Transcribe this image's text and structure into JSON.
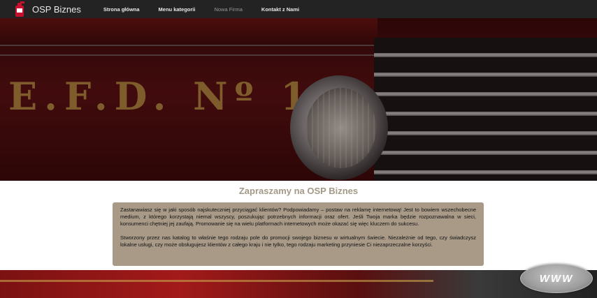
{
  "header": {
    "brand_name": "OSP Biznes",
    "logo_icon": "fire-extinguisher-icon",
    "nav_items": [
      {
        "label": "Strona główna",
        "active": false
      },
      {
        "label": "Menu kategorii",
        "active": false
      },
      {
        "label": "Nowa Firma",
        "active": true
      },
      {
        "label": "Kontakt z Nami",
        "active": false
      }
    ]
  },
  "hero": {
    "image_text": "E.F.D. Nº 1"
  },
  "main": {
    "title": "Zapraszamy na OSP Biznes",
    "paragraphs": [
      "Zastanawiasz się w jaki sposób najskuteczniej przyciągać klientów? Podpowiadamy – postaw na reklamę internetową! Jest to bowiem wszechobecne medium, z którego korzystają niemal wszyscy, poszukując potrzebnych informacji oraz ofert. Jeśli Twoja marka będzie rozpoznawalna w sieci, konsumenci chętniej jej zaufają. Promowanie się na wielu platformach internetowych może okazać się więc kluczem do sukcesu.",
      "Stworzony przez nas katalog to właśnie tego rodzaju pole do promocji swojego biznesu w wirtualnym świecie. Niezależnie od tego, czy świadczysz lokalne usługi, czy może obsługujesz klientów z całego kraju i nie tylko, tego rodzaju marketing przyniesie Ci niezaprzeczalne korzyści."
    ]
  },
  "badge": {
    "label": "WWW"
  },
  "colors": {
    "navbar_bg": "#232323",
    "box_bg": "#a89a87",
    "title_color": "#a39987",
    "brand_red": "#c8102e"
  }
}
